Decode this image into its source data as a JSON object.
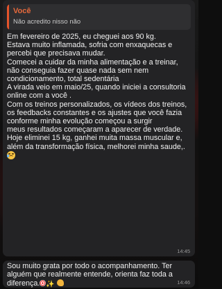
{
  "messages": [
    {
      "quote": {
        "author": "Você",
        "text": "Não acredito nisso não"
      },
      "lines": [
        "Em fevereiro de 2025, eu cheguei aos 90 kg.",
        "Estava muito inflamada, sofria com enxaquecas e percebi que precisava mudar.",
        "Comecei a cuidar da minha alimentação e a treinar, não conseguia fazer quase nada sem nem condicionamento, total sedentária",
        " A  virada veio em maio/25, quando iniciei a consultoria online com a você .",
        "Com os treinos personalizados, os vídeos dos treinos,  os feedbacks constantes e os ajustes que você fazia conforme minha evolução começou a surgir",
        "meus resultados começaram a aparecer de verdade.",
        "Hoje eliminei 15 kg, ganhei muita massa muscular e, além da transformação física, melhorei minha saude,."
      ],
      "emoji": "crying-face-emoji",
      "time": "14:45"
    },
    {
      "text": "Sou muito grata por todo o acompanhamento. Ter alguém que realmente entende, orienta  faz toda a diferença.",
      "emojis": [
        "target-emoji",
        "sparkles-emoji",
        "flexed-biceps-emoji"
      ],
      "time": "14:46"
    }
  ],
  "colors": {
    "bubble": "#232325",
    "quote_bg": "#2f2f31",
    "quote_accent": "#e5542b",
    "quote_author": "#e86a3c",
    "text": "#f2f2f2",
    "timestamp": "#9a9a9a"
  }
}
